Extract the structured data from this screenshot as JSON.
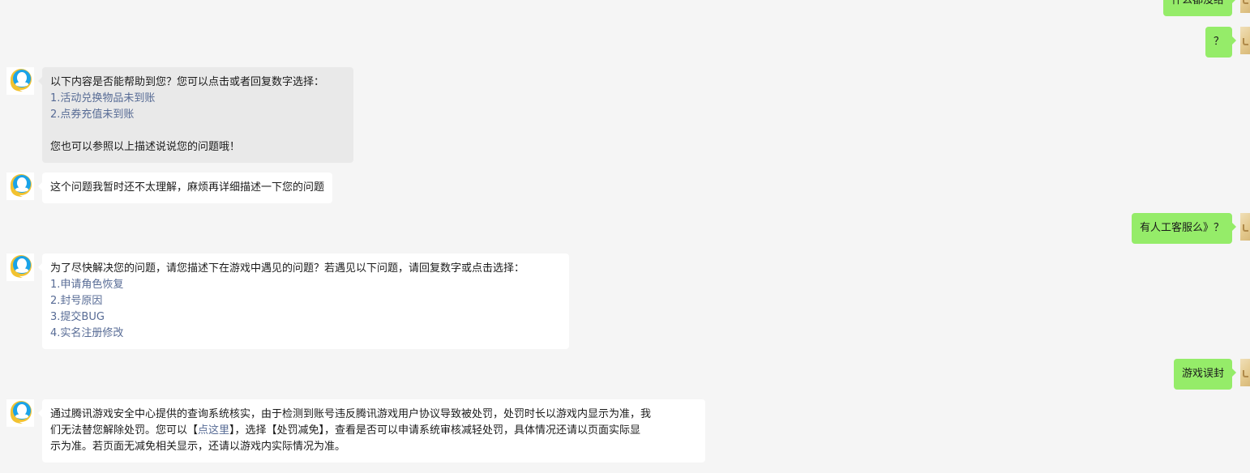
{
  "messages": {
    "user_top_partial": "什么都没给",
    "user_question_mark": "？",
    "bot_help": {
      "intro": "以下内容是否能帮助到您？您可以点击或者回复数字选择：",
      "options": [
        "1.活动兑换物品未到账",
        "2.点券充值未到账"
      ],
      "outro": "您也可以参照以上描述说说您的问题哦！"
    },
    "bot_not_understand": "这个问题我暂时还不太理解，麻烦再详细描述一下您的问题",
    "user_human_service": "有人工客服么》？",
    "bot_game_issues": {
      "intro": "为了尽快解决您的问题，请您描述下在游戏中遇见的问题？若遇见以下问题，请回复数字或点击选择：",
      "options": [
        "1.申请角色恢复",
        "2.封号原因",
        "3.提交BUG",
        "4.实名注册修改"
      ]
    },
    "user_ban": "游戏误封",
    "bot_ban_reply": {
      "line1": "通过腾讯游戏安全中心提供的查询系统核实，由于检测到账号违反腾讯游戏用户协议导致被处罚，处罚时长以游戏内显示为准，我",
      "line2_a": "们无法替您解除处罚。您可以【",
      "line2_link": "点这里",
      "line2_b": "】，选择【处罚减免】，查看是否可以申请系统审核减轻处罚，具体情况还请以页面实际显",
      "line3": "示为准。若页面无减免相关显示，还请以游戏内实际情况为准。"
    }
  },
  "colors": {
    "user_bubble": "#95ec69",
    "bot_bubble": "#ffffff",
    "bot_bubble_highlight": "#e9e9e9",
    "link": "#576b95",
    "background": "#f5f5f5"
  },
  "icons": {
    "bot_avatar": "qq-service-bot-icon",
    "user_avatar": "user-avatar-image"
  }
}
